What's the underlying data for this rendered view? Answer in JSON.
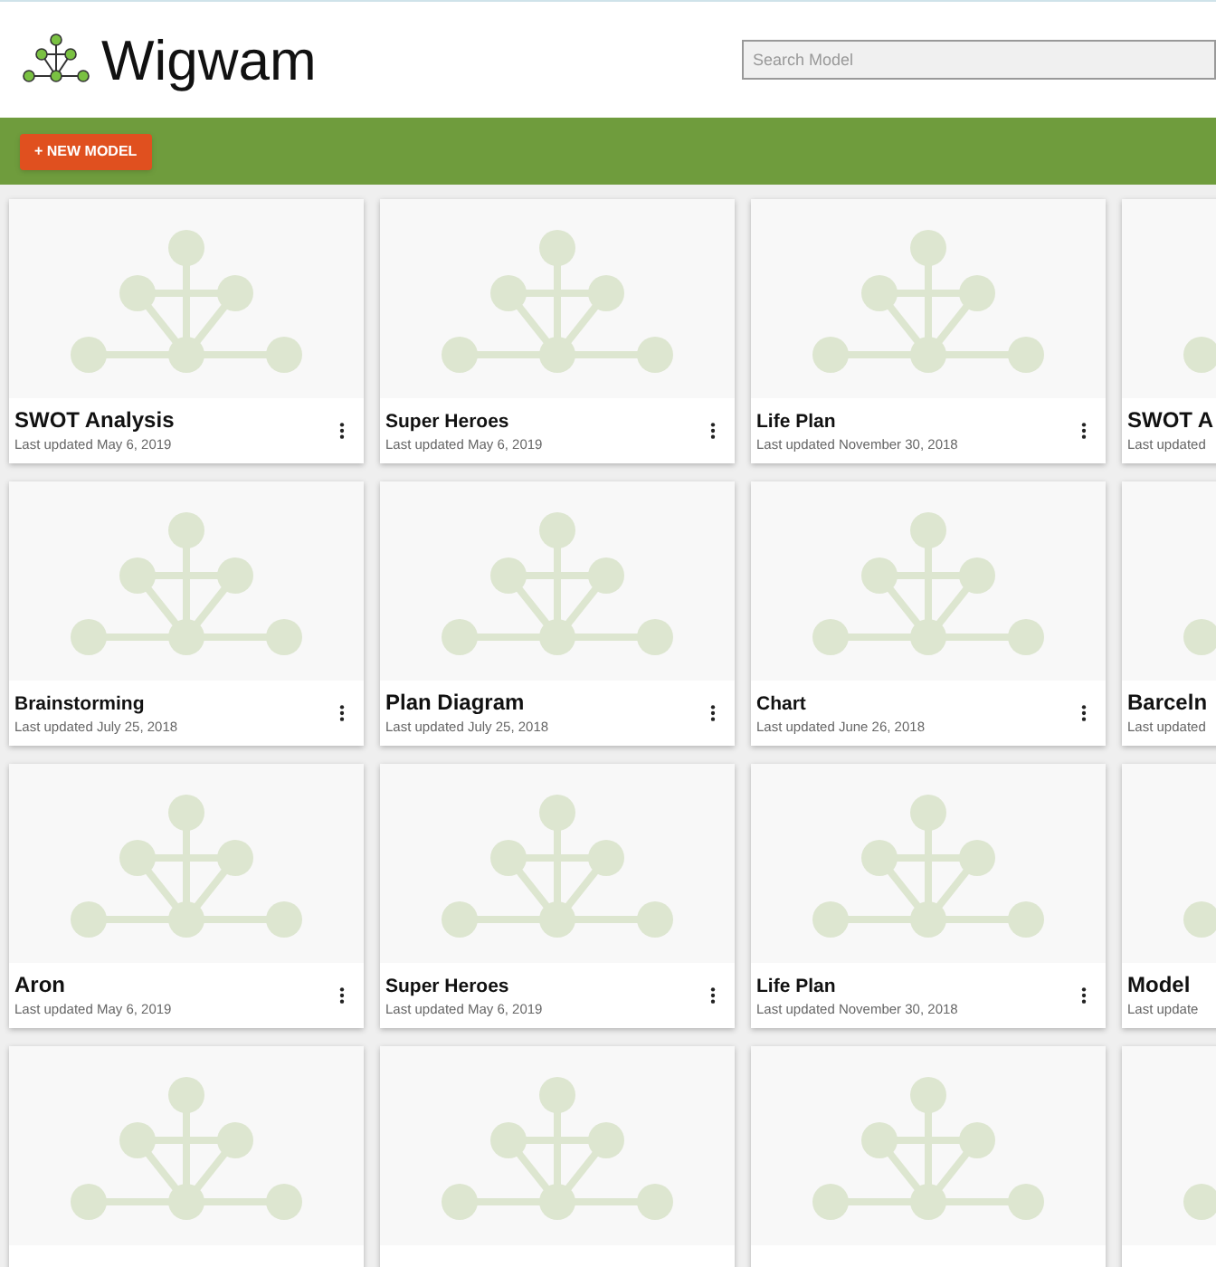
{
  "app": {
    "title": "Wigwam"
  },
  "search": {
    "placeholder": "Search Model"
  },
  "toolbar": {
    "new_button": "+ NEW MODEL"
  },
  "cards": [
    {
      "kind": "model",
      "title": "SWOT Analysis",
      "large": true,
      "updated": "Last updated May 6, 2019"
    },
    {
      "kind": "model",
      "title": "Super Heroes",
      "large": false,
      "updated": "Last updated May 6, 2019"
    },
    {
      "kind": "model",
      "title": "Life Plan",
      "large": false,
      "updated": "Last updated November 30, 2018"
    },
    {
      "kind": "model",
      "title": "SWOT A",
      "large": true,
      "updated": "Last updated"
    },
    {
      "kind": "model",
      "title": "Brainstorming",
      "large": false,
      "updated": "Last updated July 25, 2018"
    },
    {
      "kind": "model",
      "title": "Plan Diagram",
      "large": true,
      "updated": "Last updated July 25, 2018"
    },
    {
      "kind": "model",
      "title": "Chart",
      "large": false,
      "updated": "Last updated June 26, 2018"
    },
    {
      "kind": "model",
      "title": "Barceln",
      "large": true,
      "updated": "Last updated"
    },
    {
      "kind": "model",
      "title": "Aron",
      "large": true,
      "updated": "Last updated May 6, 2019"
    },
    {
      "kind": "model",
      "title": "Super Heroes",
      "large": false,
      "updated": "Last updated May 6, 2019"
    },
    {
      "kind": "model",
      "title": "Life Plan",
      "large": false,
      "updated": "Last updated November 30, 2018"
    },
    {
      "kind": "model",
      "title": "Model",
      "large": true,
      "updated": "Last update"
    },
    {
      "kind": "placeholder"
    },
    {
      "kind": "placeholder"
    },
    {
      "kind": "placeholder"
    },
    {
      "kind": "placeholder"
    }
  ]
}
